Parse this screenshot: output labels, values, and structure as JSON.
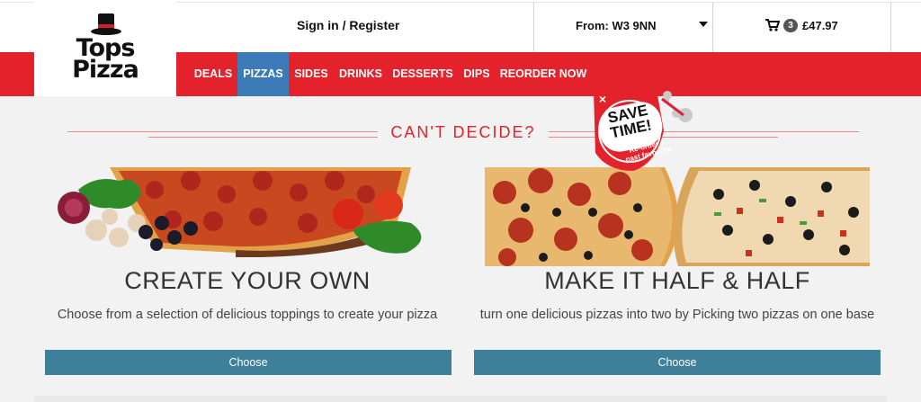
{
  "brand": {
    "logo_line1": "Tops",
    "logo_line2": "Pizza"
  },
  "header": {
    "signin_label": "Sign in",
    "separator": "/",
    "register_label": "Register",
    "postcode_label": "From: W3 9NN",
    "cart_count": "3",
    "cart_total": "£47.97"
  },
  "nav": {
    "items": [
      {
        "label": "DEALS",
        "active": false
      },
      {
        "label": "PIZZAS",
        "active": true
      },
      {
        "label": "SIDES",
        "active": false
      },
      {
        "label": "DRINKS",
        "active": false
      },
      {
        "label": "DESSERTS",
        "active": false
      },
      {
        "label": "DIPS",
        "active": false
      },
      {
        "label": "REORDER NOW",
        "active": false
      }
    ]
  },
  "section": {
    "title": "CAN'T DECIDE?"
  },
  "promo": {
    "close_glyph": "×",
    "line1": "SAVE",
    "line2": "TIME!",
    "sub1": "Re-order a",
    "sub2": "past favourite"
  },
  "cards": [
    {
      "title": "CREATE YOUR OWN",
      "description": "Choose from a selection of delicious toppings to create your pizza",
      "button_label": "Choose"
    },
    {
      "title": "MAKE IT HALF & HALF",
      "description": "turn one delicious pizzas into two by Picking two pizzas on one base",
      "button_label": "Choose"
    }
  ],
  "colors": {
    "brand_red": "#e3222b",
    "active_nav_blue": "#3d7bb8",
    "button_teal": "#3e7f99",
    "background": "#f2f2f2"
  }
}
